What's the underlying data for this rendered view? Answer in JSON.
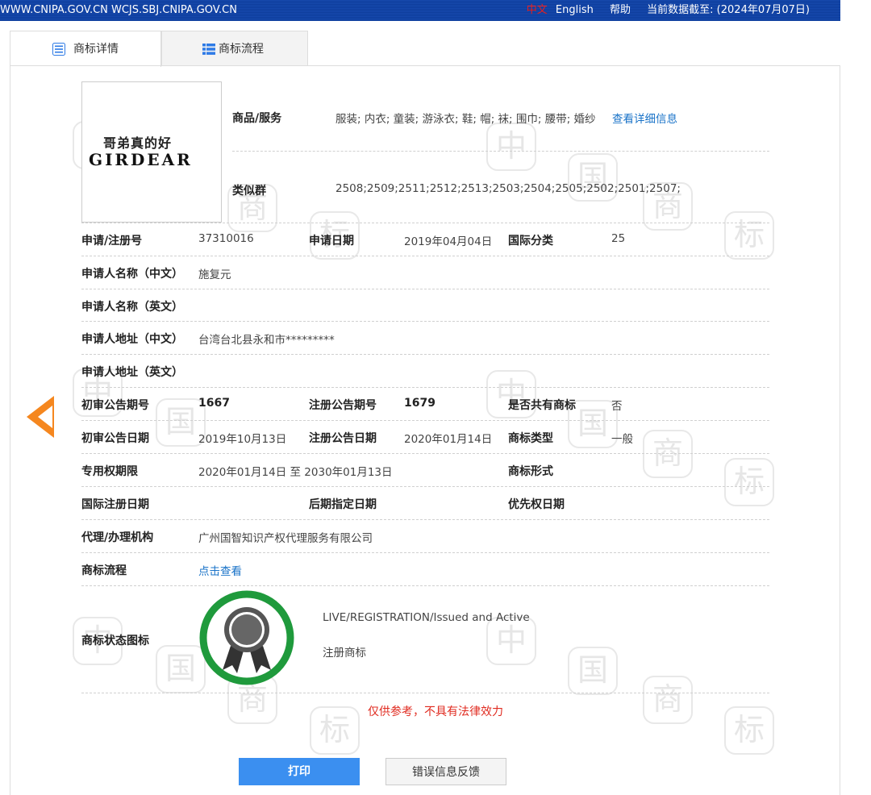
{
  "topbar": {
    "sites": "WWW.CNIPA.GOV.CN WCJS.SBJ.CNIPA.GOV.CN",
    "lang_zh": "中文",
    "lang_en": "English",
    "help": "帮助",
    "data_date": "当前数据截至: (2024年07月07日)"
  },
  "tabs": [
    {
      "label": "商标详情",
      "icon": "list-icon"
    },
    {
      "label": "商标流程",
      "icon": "grid-list-icon"
    }
  ],
  "logo": {
    "line1": "哥弟真的好",
    "line2": "GIRDEAR"
  },
  "goods": {
    "label": "商品/服务",
    "value": "服装; 内衣; 童装; 游泳衣; 鞋; 帽; 袜; 围巾; 腰带; 婚纱",
    "link": "查看详细信息"
  },
  "similar": {
    "label": "类似群",
    "value": "2508;2509;2511;2512;2513;2503;2504;2505;2502;2501;2507;"
  },
  "rows": {
    "reg_no_label": "申请/注册号",
    "reg_no": "37310016",
    "apply_date_label": "申请日期",
    "apply_date": "2019年04月04日",
    "intl_class_label": "国际分类",
    "intl_class": "25",
    "applicant_cn_label": "申请人名称（中文）",
    "applicant_cn": "施复元",
    "applicant_en_label": "申请人名称（英文）",
    "applicant_en": "",
    "addr_cn_label": "申请人地址（中文）",
    "addr_cn": "台湾台北县永和市*********",
    "addr_en_label": "申请人地址（英文）",
    "addr_en": "",
    "prelim_no_label": "初审公告期号",
    "prelim_no": "1667",
    "reg_pub_no_label": "注册公告期号",
    "reg_pub_no": "1679",
    "shared_label": "是否共有商标",
    "shared": "否",
    "prelim_date_label": "初审公告日期",
    "prelim_date": "2019年10月13日",
    "reg_pub_date_label": "注册公告日期",
    "reg_pub_date": "2020年01月14日",
    "tm_type_label": "商标类型",
    "tm_type": "一般",
    "term_label": "专用权期限",
    "term": "2020年01月14日 至 2030年01月13日",
    "tm_form_label": "商标形式",
    "tm_form": "",
    "intl_reg_date_label": "国际注册日期",
    "intl_reg_date": "",
    "later_date_label": "后期指定日期",
    "later_date": "",
    "priority_label": "优先权日期",
    "priority": "",
    "agent_label": "代理/办理机构",
    "agent": "广州国智知识产权代理服务有限公司",
    "flow_label": "商标流程",
    "flow_link": "点击查看"
  },
  "status": {
    "label": "商标状态图标",
    "en": "LIVE/REGISTRATION/Issued and Active",
    "cn": "注册商标",
    "ring_color": "#1f9a3c"
  },
  "notice": "仅供参考，不具有法律效力",
  "buttons": {
    "print": "打印",
    "feedback": "错误信息反馈"
  },
  "colors": {
    "topbar": "#0d3c9b",
    "accent": "#3b8ff0",
    "arrow": "#f5871f",
    "notice": "#e02b20"
  }
}
